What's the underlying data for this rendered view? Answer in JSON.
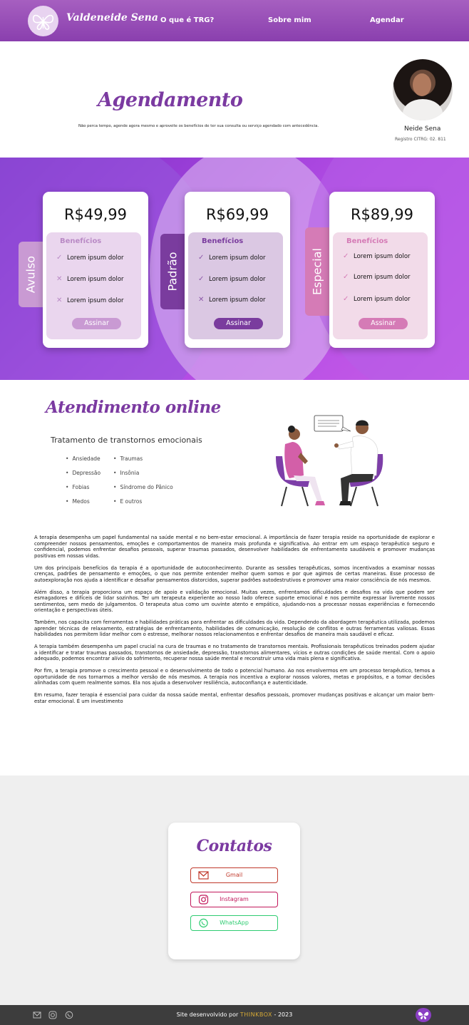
{
  "nav": {
    "brand": "Valdeneide Sena",
    "links": [
      "O que é TRG?",
      "Sobre mim",
      "Agendar"
    ],
    "accent": "#8a3fae"
  },
  "hero": {
    "title": "Agendamento",
    "subtitle": "Não perca tempo, agende agora mesmo e aproveite os benefícios de ter sua consulta ou serviço agendado com antecedência.",
    "profile_name": "Neide Sena",
    "registry": "Registro CITRG: 02. 811"
  },
  "plans": [
    {
      "name": "Avulso",
      "price": "R$49,99",
      "benefits_title": "Benefícios",
      "benefits": [
        {
          "text": "Lorem ipsum dolor",
          "included": true
        },
        {
          "text": "Lorem ipsum dolor",
          "included": false
        },
        {
          "text": "Lorem ipsum dolor",
          "included": false
        }
      ],
      "button": "Assinar",
      "color": "#c99ad3"
    },
    {
      "name": "Padrão",
      "price": "R$69,99",
      "benefits_title": "Benefícios",
      "benefits": [
        {
          "text": "Lorem ipsum dolor",
          "included": true
        },
        {
          "text": "Lorem ipsum dolor",
          "included": true
        },
        {
          "text": "Lorem ipsum dolor",
          "included": false
        }
      ],
      "button": "Assinar",
      "color": "#7a3c9e"
    },
    {
      "name": "Especial",
      "price": "R$89,99",
      "benefits_title": "Benefícios",
      "benefits": [
        {
          "text": "Lorem ipsum dolor",
          "included": true
        },
        {
          "text": "Lorem ipsum dolor",
          "included": true
        },
        {
          "text": "Lorem ipsum dolor",
          "included": true
        }
      ],
      "button": "Assinar",
      "color": "#d57bb6"
    }
  ],
  "online": {
    "title": "Atendimento online",
    "subtitle": "Tratamento de transtornos emocionais",
    "conditions_left": [
      "Ansiedade",
      "Depressão",
      "Fobias",
      "Medos"
    ],
    "conditions_right": [
      "Traumas",
      "Insônia",
      "Síndrome do Pânico",
      "E outros"
    ],
    "paragraphs": [
      "A terapia desempenha um papel fundamental na saúde mental e no bem-estar emocional. A importância de fazer terapia reside na oportunidade de explorar e compreender nossos pensamentos, emoções e comportamentos de maneira mais profunda e significativa. Ao entrar em um espaço terapêutico seguro e confidencial, podemos enfrentar desafios pessoais, superar traumas passados, desenvolver habilidades de enfrentamento saudáveis e promover mudanças positivas em nossas vidas.",
      "Um dos principais benefícios da terapia é a oportunidade de autoconhecimento. Durante as sessões terapêuticas, somos incentivados a examinar nossas crenças, padrões de pensamento e emoções, o que nos permite entender melhor quem somos e por que agimos de certas maneiras. Esse processo de autoexploração nos ajuda a identificar e desafiar pensamentos distorcidos, superar padrões autodestrutivos e promover uma maior consciência de nós mesmos.",
      "Além disso, a terapia proporciona um espaço de apoio e validação emocional. Muitas vezes, enfrentamos dificuldades e desafios na vida que podem ser esmagadores e difíceis de lidar sozinhos. Ter um terapeuta experiente ao nosso lado oferece suporte emocional e nos permite expressar livremente nossos sentimentos, sem medo de julgamentos. O terapeuta atua como um ouvinte atento e empático, ajudando-nos a processar nossas experiências e fornecendo orientação e perspectivas úteis.",
      "Também, nos capacita com ferramentas e habilidades práticas para enfrentar as dificuldades da vida. Dependendo da abordagem terapêutica utilizada, podemos aprender técnicas de relaxamento, estratégias de enfrentamento, habilidades de comunicação, resolução de conflitos e outras ferramentas valiosas. Essas habilidades nos permitem lidar melhor com o estresse, melhorar nossos relacionamentos e enfrentar desafios de maneira mais saudável e eficaz.",
      "A terapia também desempenha um papel crucial na cura de traumas e no tratamento de transtornos mentais. Profissionais terapêuticos treinados podem ajudar a identificar e tratar traumas passados, transtornos de ansiedade, depressão, transtornos alimentares, vícios e outras condições de saúde mental. Com o apoio adequado, podemos encontrar alívio do sofrimento, recuperar nossa saúde mental e reconstruir uma vida mais plena e significativa.",
      "Por fim, a terapia promove o crescimento pessoal e o desenvolvimento de todo o potencial humano. Ao nos envolvermos em um processo terapêutico, temos a oportunidade de nos tornarmos a melhor versão de nós mesmos. A terapia nos incentiva a explorar nossos valores, metas e propósitos, e a tomar decisões alinhadas com quem realmente somos. Ela nos ajuda a desenvolver resiliência, autoconfiança e autenticidade.",
      "Em resumo, fazer terapia é essencial para cuidar da nossa saúde mental, enfrentar desafios pessoais, promover mudanças positivas e alcançar um maior bem-estar emocional. É um investimento"
    ]
  },
  "contacts": {
    "title": "Contatos",
    "buttons": [
      {
        "label": "Gmail",
        "color": "#c0392b",
        "icon": "mail-icon"
      },
      {
        "label": "Instagram",
        "color": "#c2185b",
        "icon": "instagram-icon"
      },
      {
        "label": "WhatsApp",
        "color": "#2ecc71",
        "icon": "whatsapp-icon"
      }
    ]
  },
  "footer": {
    "text_before": "Site desenvolvido por ",
    "brand": "THINKBOX",
    "text_after": " - 2023",
    "icons": [
      "mail-icon",
      "instagram-icon",
      "whatsapp-icon"
    ]
  }
}
